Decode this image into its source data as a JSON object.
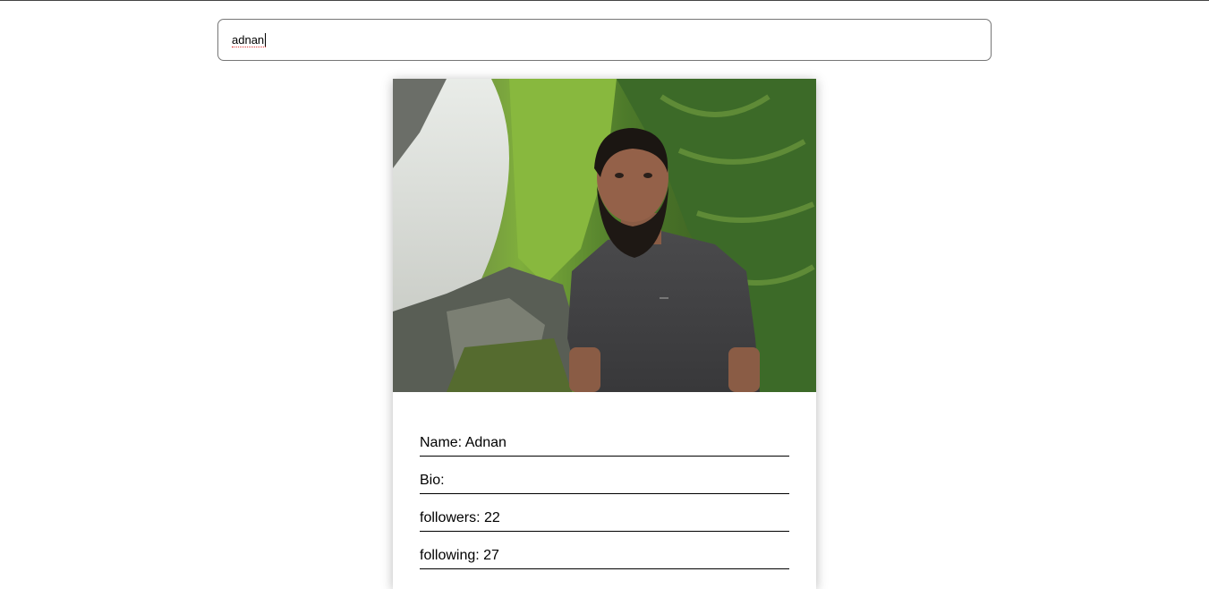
{
  "search": {
    "value": "adnan",
    "placeholder": ""
  },
  "profile": {
    "photo_alt": "profile photo",
    "name_line": "Name: Adnan",
    "bio_line": "Bio:",
    "followers_line": "followers: 22",
    "following_line": "following: 27"
  },
  "colors": {
    "border": "#767676",
    "text": "#000000",
    "background": "#ffffff"
  }
}
